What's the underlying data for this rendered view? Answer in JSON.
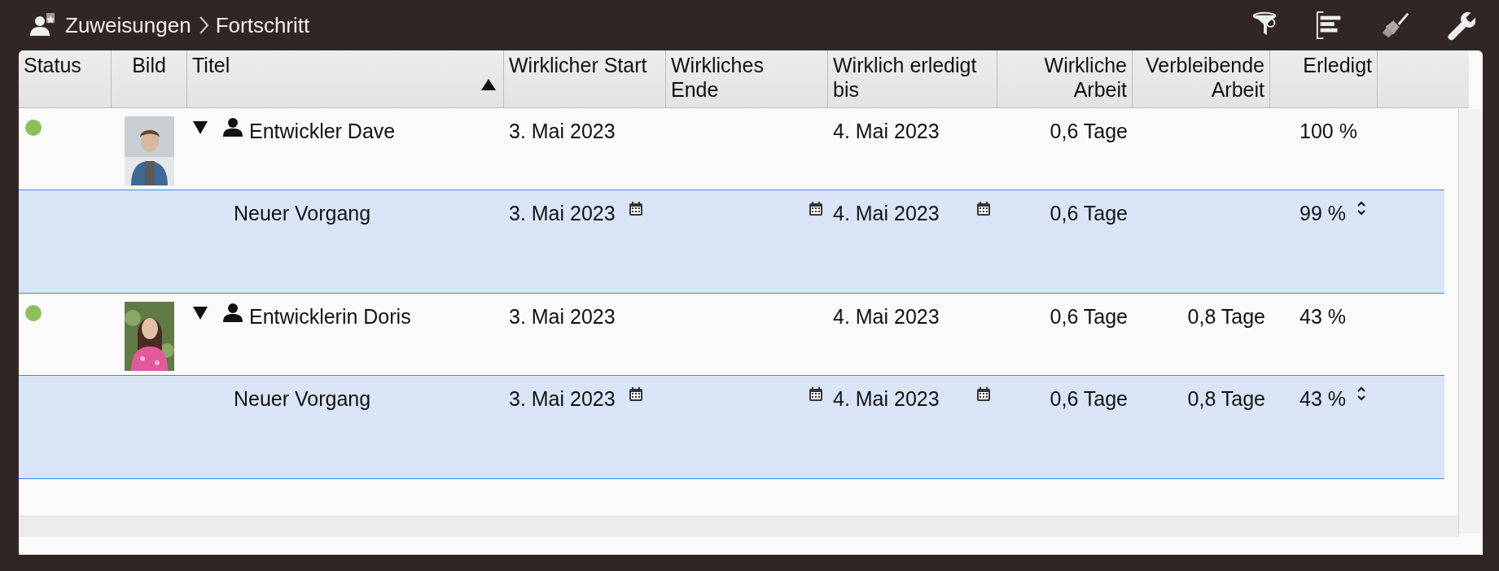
{
  "breadcrumb": [
    "Zuweisungen",
    "Fortschritt"
  ],
  "table": {
    "columns": [
      {
        "label": "Status",
        "sorted": false
      },
      {
        "label": "Bild",
        "sorted": false
      },
      {
        "label": "Titel",
        "sorted": true
      },
      {
        "label": "Wirklicher Start",
        "sorted": false
      },
      {
        "label": "Wirkliches Ende",
        "sorted": false
      },
      {
        "label": "Wirklich erledigt bis",
        "sorted": false
      },
      {
        "label": "Wirkliche Arbeit",
        "sorted": false
      },
      {
        "label": "Verbleibende Arbeit",
        "sorted": false
      },
      {
        "label": "Erledigt",
        "sorted": false
      }
    ],
    "rows": [
      {
        "kind": "resource",
        "color": "#8cc15a",
        "photo": true,
        "expanded": true,
        "title": "Entwickler Dave",
        "start": "3. Mai 2023",
        "done_until": "4. Mai 2023",
        "work": "0,6 Tage",
        "percent": "100 %"
      },
      {
        "kind": "task",
        "title": "Neuer Vorgang",
        "start": "3. Mai 2023",
        "done_until": "4. Mai 2023",
        "work": "0,6 Tage",
        "percent": "99 %"
      },
      {
        "kind": "resource",
        "color": "#8cc15a",
        "photo": true,
        "expanded": true,
        "title": "Entwicklerin Doris",
        "start": "3. Mai 2023",
        "done_until": "4. Mai 2023",
        "work": "0,6 Tage",
        "remaining": "0,8 Tage",
        "percent": "43 %"
      },
      {
        "kind": "task",
        "title": "Neuer Vorgang",
        "start": "3. Mai 2023",
        "done_until": "4. Mai 2023",
        "work": "0,6 Tage",
        "remaining": "0,8 Tage",
        "percent": "43 %"
      }
    ]
  }
}
